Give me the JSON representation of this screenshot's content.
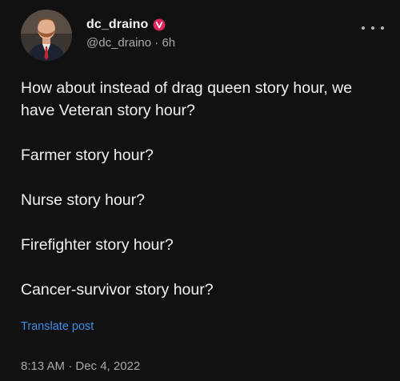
{
  "author": {
    "display_name": "dc_draino",
    "handle": "@dc_draino",
    "separator": " · ",
    "relative_time": "6h",
    "verified_badge_color": "#e0245e"
  },
  "post": {
    "paragraphs": [
      "How about instead of drag queen story hour, we have Veteran story hour?",
      "Farmer story hour?",
      "Nurse story hour?",
      "Firefighter story hour?",
      "Cancer-survivor story hour?"
    ],
    "translate_label": "Translate post",
    "timestamp": "8:13 AM · Dec 4, 2022"
  },
  "icons": {
    "more": "more-horizontal-icon",
    "verified": "verified-badge-icon"
  },
  "colors": {
    "background": "#111111",
    "text_primary": "#f2f2f2",
    "text_secondary": "#a9a9a9",
    "link": "#3d8fe6"
  }
}
